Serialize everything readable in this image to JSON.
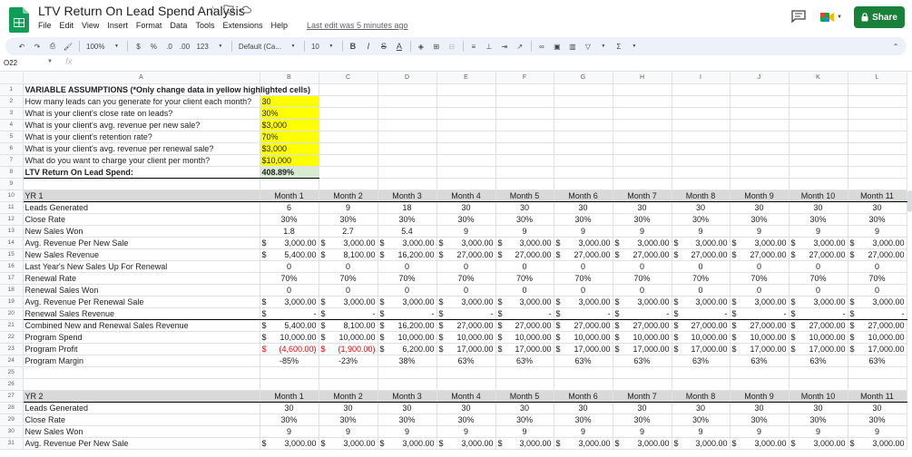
{
  "app": {
    "title": "LTV Return On Lead Spend Analysis",
    "menu": [
      "File",
      "Edit",
      "View",
      "Insert",
      "Format",
      "Data",
      "Tools",
      "Extensions",
      "Help"
    ],
    "last_edit": "Last edit was 5 minutes ago",
    "share_label": "Share",
    "brand_color": "#188038"
  },
  "toolbar": {
    "zoom": "100%",
    "currency": "$",
    "percent": "%",
    "dec_decrease": ".0",
    "dec_increase": ".00",
    "more_formats": "123",
    "font": "Default (Ca...",
    "font_size": "10",
    "bold": "B",
    "italic": "I",
    "strike": "S",
    "textcolor": "A"
  },
  "formula_bar": {
    "cell_ref": "O22",
    "fx": "fx",
    "value": ""
  },
  "columns": [
    "A",
    "B",
    "C",
    "D",
    "E",
    "F",
    "G",
    "H",
    "I",
    "J",
    "K",
    "L"
  ],
  "assumptions": {
    "header": "VARIABLE ASSUMPTIONS (*Only change data in yellow highlighted cells)",
    "rows": [
      {
        "label": "How many leads can you generate for your client each month?",
        "value": "30"
      },
      {
        "label": "What is your client's close rate on leads?",
        "value": "30%"
      },
      {
        "label": "What is your client's avg. revenue per new sale?",
        "value": "$3,000"
      },
      {
        "label": "What is your client's retention rate?",
        "value": "70%"
      },
      {
        "label": "What is your client's avg. revenue per renewal sale?",
        "value": "$3,000"
      },
      {
        "label": "What do you want to charge your client per month?",
        "value": "$10,000"
      }
    ],
    "result_label": "LTV Return On Lead Spend:",
    "result_value": "408.89%"
  },
  "yr1": {
    "title": "YR 1",
    "months": [
      "Month 1",
      "Month 2",
      "Month 3",
      "Month 4",
      "Month 5",
      "Month 6",
      "Month 7",
      "Month 8",
      "Month 9",
      "Month 10",
      "Month 11"
    ],
    "rows": [
      {
        "label": "Leads Generated",
        "type": "plain",
        "values": [
          "6",
          "9",
          "18",
          "30",
          "30",
          "30",
          "30",
          "30",
          "30",
          "30",
          "30"
        ]
      },
      {
        "label": "Close Rate",
        "type": "plain",
        "values": [
          "30%",
          "30%",
          "30%",
          "30%",
          "30%",
          "30%",
          "30%",
          "30%",
          "30%",
          "30%",
          "30%"
        ]
      },
      {
        "label": "New Sales Won",
        "type": "plain",
        "values": [
          "1.8",
          "2.7",
          "5.4",
          "9",
          "9",
          "9",
          "9",
          "9",
          "9",
          "9",
          "9"
        ]
      },
      {
        "label": "Avg. Revenue Per New Sale",
        "type": "acct",
        "values": [
          "3,000.00",
          "3,000.00",
          "3,000.00",
          "3,000.00",
          "3,000.00",
          "3,000.00",
          "3,000.00",
          "3,000.00",
          "3,000.00",
          "3,000.00",
          "3,000.00"
        ]
      },
      {
        "label": "New Sales Revenue",
        "type": "acct",
        "values": [
          "5,400.00",
          "8,100.00",
          "16,200.00",
          "27,000.00",
          "27,000.00",
          "27,000.00",
          "27,000.00",
          "27,000.00",
          "27,000.00",
          "27,000.00",
          "27,000.00"
        ]
      },
      {
        "label": "Last Year's New Sales Up For Renewal",
        "type": "plain",
        "values": [
          "0",
          "0",
          "0",
          "0",
          "0",
          "0",
          "0",
          "0",
          "0",
          "0",
          "0"
        ]
      },
      {
        "label": "Renewal Rate",
        "type": "plain",
        "values": [
          "70%",
          "70%",
          "70%",
          "70%",
          "70%",
          "70%",
          "70%",
          "70%",
          "70%",
          "70%",
          "70%"
        ]
      },
      {
        "label": "Renewal Sales Won",
        "type": "plain",
        "values": [
          "0",
          "0",
          "0",
          "0",
          "0",
          "0",
          "0",
          "0",
          "0",
          "0",
          "0"
        ]
      },
      {
        "label": "Avg. Revenue Per Renewal Sale",
        "type": "acct",
        "values": [
          "3,000.00",
          "3,000.00",
          "3,000.00",
          "3,000.00",
          "3,000.00",
          "3,000.00",
          "3,000.00",
          "3,000.00",
          "3,000.00",
          "3,000.00",
          "3,000.00"
        ]
      },
      {
        "label": "Renewal Sales Revenue",
        "type": "acct",
        "values": [
          "-",
          "-",
          "-",
          "-",
          "-",
          "-",
          "-",
          "-",
          "-",
          "-",
          "-"
        ]
      },
      {
        "label": "Combined New and Renewal Sales Revenue",
        "type": "acct",
        "values": [
          "5,400.00",
          "8,100.00",
          "16,200.00",
          "27,000.00",
          "27,000.00",
          "27,000.00",
          "27,000.00",
          "27,000.00",
          "27,000.00",
          "27,000.00",
          "27,000.00"
        ]
      },
      {
        "label": "Program Spend",
        "type": "acct",
        "values": [
          "10,000.00",
          "10,000.00",
          "10,000.00",
          "10,000.00",
          "10,000.00",
          "10,000.00",
          "10,000.00",
          "10,000.00",
          "10,000.00",
          "10,000.00",
          "10,000.00"
        ]
      },
      {
        "label": "Program Profit",
        "type": "acct",
        "negative_color": "#e00000",
        "values": [
          "(4,600.00)",
          "(1,900.00)",
          "6,200.00",
          "17,000.00",
          "17,000.00",
          "17,000.00",
          "17,000.00",
          "17,000.00",
          "17,000.00",
          "17,000.00",
          "17,000.00"
        ]
      },
      {
        "label": "Program Margin",
        "type": "plain",
        "values": [
          "-85%",
          "-23%",
          "38%",
          "63%",
          "63%",
          "63%",
          "63%",
          "63%",
          "63%",
          "63%",
          "63%"
        ]
      }
    ]
  },
  "yr2": {
    "title": "YR 2",
    "months": [
      "Month 1",
      "Month 2",
      "Month 3",
      "Month 4",
      "Month 5",
      "Month 6",
      "Month 7",
      "Month 8",
      "Month 9",
      "Month 10",
      "Month 11"
    ],
    "rows": [
      {
        "label": "Leads Generated",
        "type": "plain",
        "values": [
          "30",
          "30",
          "30",
          "30",
          "30",
          "30",
          "30",
          "30",
          "30",
          "30",
          "30"
        ]
      },
      {
        "label": "Close Rate",
        "type": "plain",
        "values": [
          "30%",
          "30%",
          "30%",
          "30%",
          "30%",
          "30%",
          "30%",
          "30%",
          "30%",
          "30%",
          "30%"
        ]
      },
      {
        "label": "New Sales Won",
        "type": "plain",
        "values": [
          "9",
          "9",
          "9",
          "9",
          "9",
          "9",
          "9",
          "9",
          "9",
          "9",
          "9"
        ]
      },
      {
        "label": "Avg. Revenue Per New Sale",
        "type": "acct",
        "values": [
          "3,000.00",
          "3,000.00",
          "3,000.00",
          "3,000.00",
          "3,000.00",
          "3,000.00",
          "3,000.00",
          "3,000.00",
          "3,000.00",
          "3,000.00",
          "3,000.00"
        ]
      }
    ]
  },
  "colors": {
    "yellow_highlight": "#ffff00",
    "result_fill": "#d9ead3",
    "section_fill": "#d9d9d9",
    "negative": "#e00000"
  }
}
